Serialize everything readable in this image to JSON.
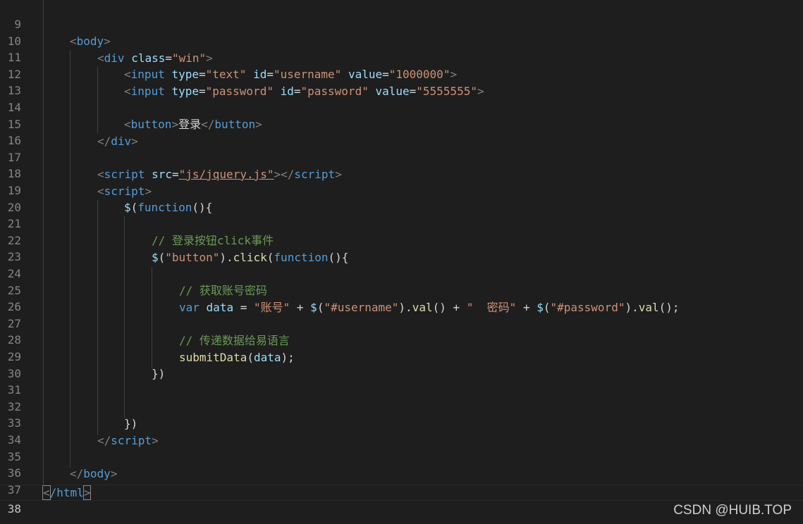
{
  "editor": {
    "active_line": "38",
    "lines": [
      {
        "num": "9"
      },
      {
        "num": "10"
      },
      {
        "num": "11",
        "t": [
          "<",
          "body",
          ">"
        ]
      },
      {
        "num": "12",
        "t": [
          "<",
          "div",
          " ",
          "class",
          "=",
          "\"win\"",
          ">"
        ]
      },
      {
        "num": "13",
        "t": [
          "<",
          "input",
          " ",
          "type",
          "=",
          "\"text\"",
          " ",
          "id",
          "=",
          "\"username\"",
          " ",
          "value",
          "=",
          "\"1000000\"",
          ">"
        ]
      },
      {
        "num": "14",
        "t": [
          "<",
          "input",
          " ",
          "type",
          "=",
          "\"password\"",
          " ",
          "id",
          "=",
          "\"password\"",
          " ",
          "value",
          "=",
          "\"5555555\"",
          ">"
        ]
      },
      {
        "num": "15"
      },
      {
        "num": "16",
        "t": [
          "<",
          "button",
          ">",
          "登录",
          "</",
          "button",
          ">"
        ]
      },
      {
        "num": "17",
        "t": [
          "</",
          "div",
          ">"
        ]
      },
      {
        "num": "18"
      },
      {
        "num": "19",
        "t": [
          "<",
          "script",
          " ",
          "src",
          "=",
          "\"js/jquery.js\"",
          "></",
          "script",
          ">"
        ]
      },
      {
        "num": "20",
        "t": [
          "<",
          "script",
          ">"
        ]
      },
      {
        "num": "21",
        "t": [
          "$",
          "(",
          "function",
          "(){"
        ]
      },
      {
        "num": "22"
      },
      {
        "num": "23",
        "t": [
          "// 登录按钮click事件"
        ]
      },
      {
        "num": "24",
        "t": [
          "$",
          "(",
          "\"button\"",
          ").",
          "click",
          "(",
          "function",
          "(){"
        ]
      },
      {
        "num": "25"
      },
      {
        "num": "26",
        "t": [
          "// 获取账号密码"
        ]
      },
      {
        "num": "27",
        "t": [
          "var",
          " ",
          "data",
          " = ",
          "\"账号\"",
          " + ",
          "$",
          "(",
          "\"#username\"",
          ").",
          "val",
          "() + ",
          "\"  密码\"",
          " + ",
          "$",
          "(",
          "\"#password\"",
          ").",
          "val",
          "();"
        ]
      },
      {
        "num": "28"
      },
      {
        "num": "29",
        "t": [
          "// 传递数据给易语言"
        ]
      },
      {
        "num": "30",
        "t": [
          "submitData",
          "(",
          "data",
          ");"
        ]
      },
      {
        "num": "31",
        "t": [
          "})"
        ]
      },
      {
        "num": "32"
      },
      {
        "num": "33"
      },
      {
        "num": "34",
        "t": [
          "})"
        ]
      },
      {
        "num": "35",
        "t": [
          "</",
          "script",
          ">"
        ]
      },
      {
        "num": "36"
      },
      {
        "num": "37",
        "t": [
          "</",
          "body",
          ">"
        ]
      },
      {
        "num": "38",
        "t": [
          "<",
          "/html",
          ">"
        ]
      }
    ]
  },
  "watermark": "CSDN @HUIB.TOP",
  "colors": {
    "background": "#1e1e1e",
    "tag": "#569cd6",
    "attribute": "#9cdcfe",
    "string": "#ce9178",
    "comment": "#6a9955",
    "function": "#dcdcaa",
    "punctuation": "#808080",
    "line_number": "#858585"
  }
}
